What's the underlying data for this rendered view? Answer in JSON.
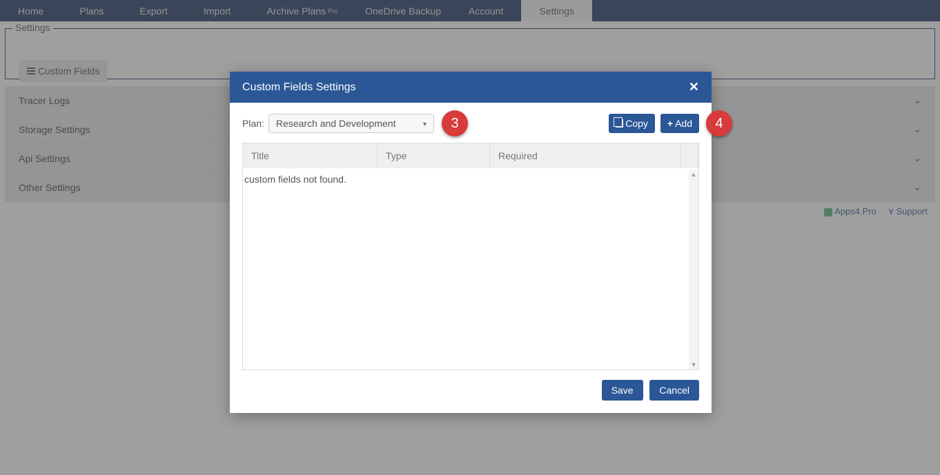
{
  "nav": {
    "items": [
      {
        "label": "Home"
      },
      {
        "label": "Plans"
      },
      {
        "label": "Export"
      },
      {
        "label": "Import"
      },
      {
        "label": "Archive Plans",
        "badge": "Pro"
      },
      {
        "label": "OneDrive Backup"
      },
      {
        "label": "Account"
      },
      {
        "label": "Settings"
      }
    ],
    "active_label": "Settings"
  },
  "settings_box": {
    "legend": "Settings",
    "custom_fields_btn": "Custom Fields"
  },
  "accordion": [
    "Tracer Logs",
    "Storage Settings",
    "Api Settings",
    "Other Settings"
  ],
  "footer": {
    "app": "Apps4.Pro",
    "support": "Support"
  },
  "modal": {
    "title": "Custom Fields Settings",
    "plan_label": "Plan:",
    "plan_value": "Research and Development",
    "copy": "Copy",
    "add": "Add",
    "cols": {
      "title": "Title",
      "type": "Type",
      "required": "Required"
    },
    "empty_msg": "custom fields not found.",
    "save": "Save",
    "cancel": "Cancel"
  },
  "callouts": {
    "c3": "3",
    "c4": "4"
  }
}
